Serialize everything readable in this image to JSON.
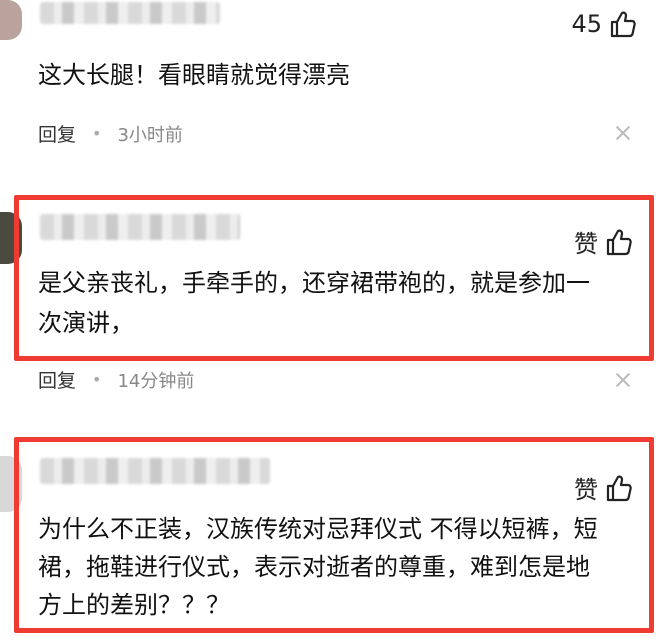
{
  "comments": [
    {
      "likes": "45",
      "text": "这大长腿！看眼睛就觉得漂亮",
      "reply_label": "回复",
      "time": "3小时前"
    },
    {
      "likes": "赞",
      "text_line1": "是父亲丧礼，手牵手的，还穿裙带袍的，就是参加一",
      "text_line2": "次演讲，",
      "reply_label": "回复",
      "time": "14分钟前"
    },
    {
      "likes": "赞",
      "text_line1": "为什么不正装，汉族传统对忌拜仪式 不得以短裤，短",
      "text_line2": "裙，拖鞋进行仪式，表示对逝者的尊重，难到怎是地",
      "text_line3": "方上的差别？？？"
    }
  ],
  "colors": {
    "highlight": "#ef3b32",
    "meta_time": "#888888"
  },
  "icons": [
    "thumbs-up-icon",
    "close-icon"
  ]
}
